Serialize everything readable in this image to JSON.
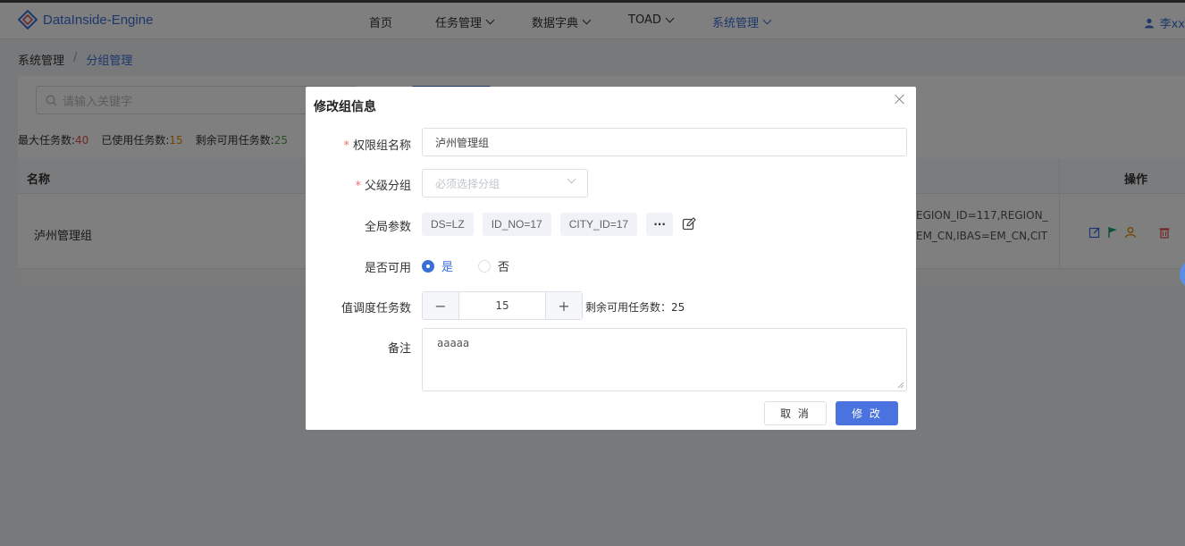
{
  "app": {
    "brand": "DataInside-Engine",
    "brand_color": "#3a6fd8",
    "user_name": "李xx"
  },
  "nav": {
    "items": [
      {
        "label": "首页"
      },
      {
        "label": "任务管理"
      },
      {
        "label": "数据字典"
      },
      {
        "label": "TOAD"
      },
      {
        "label": "系统管理"
      }
    ]
  },
  "breadcrumb": {
    "root": "系统管理",
    "separator": "/",
    "current": "分组管理"
  },
  "search": {
    "placeholder": "请输入关键字"
  },
  "stats": {
    "max_label": "最大任务数:",
    "max_value": "40",
    "used_label": "已使用任务数:",
    "used_value": "15",
    "remain_label": "剩余可用任务数:",
    "remain_value": "25"
  },
  "table": {
    "headers": {
      "name": "名称",
      "ops": "操作"
    },
    "rows": [
      {
        "name": "泸州管理组",
        "params_line1": "EGION_ID=117,REGION_",
        "params_line2": "EM_CN,IBAS=EM_CN,CIT"
      }
    ]
  },
  "modal": {
    "title": "修改组信息",
    "fields": {
      "group_name_label": "权限组名称",
      "group_name_value": "泸州管理组",
      "parent_label": "父级分组",
      "parent_placeholder": "必须选择分组",
      "params_label": "全局参数",
      "params_tags": [
        "DS=LZ",
        "ID_NO=17",
        "CITY_ID=17"
      ],
      "params_more": "···",
      "enabled_label": "是否可用",
      "enabled_yes": "是",
      "enabled_no": "否",
      "enabled_selected": "是",
      "schedule_label": "值调度任务数",
      "schedule_value": "15",
      "remain_text": "剩余可用任务数：25",
      "remark_label": "备注",
      "remark_value": "aaaaa"
    },
    "required_mark": "*",
    "buttons": {
      "cancel": "取 消",
      "ok": "修 改"
    }
  }
}
